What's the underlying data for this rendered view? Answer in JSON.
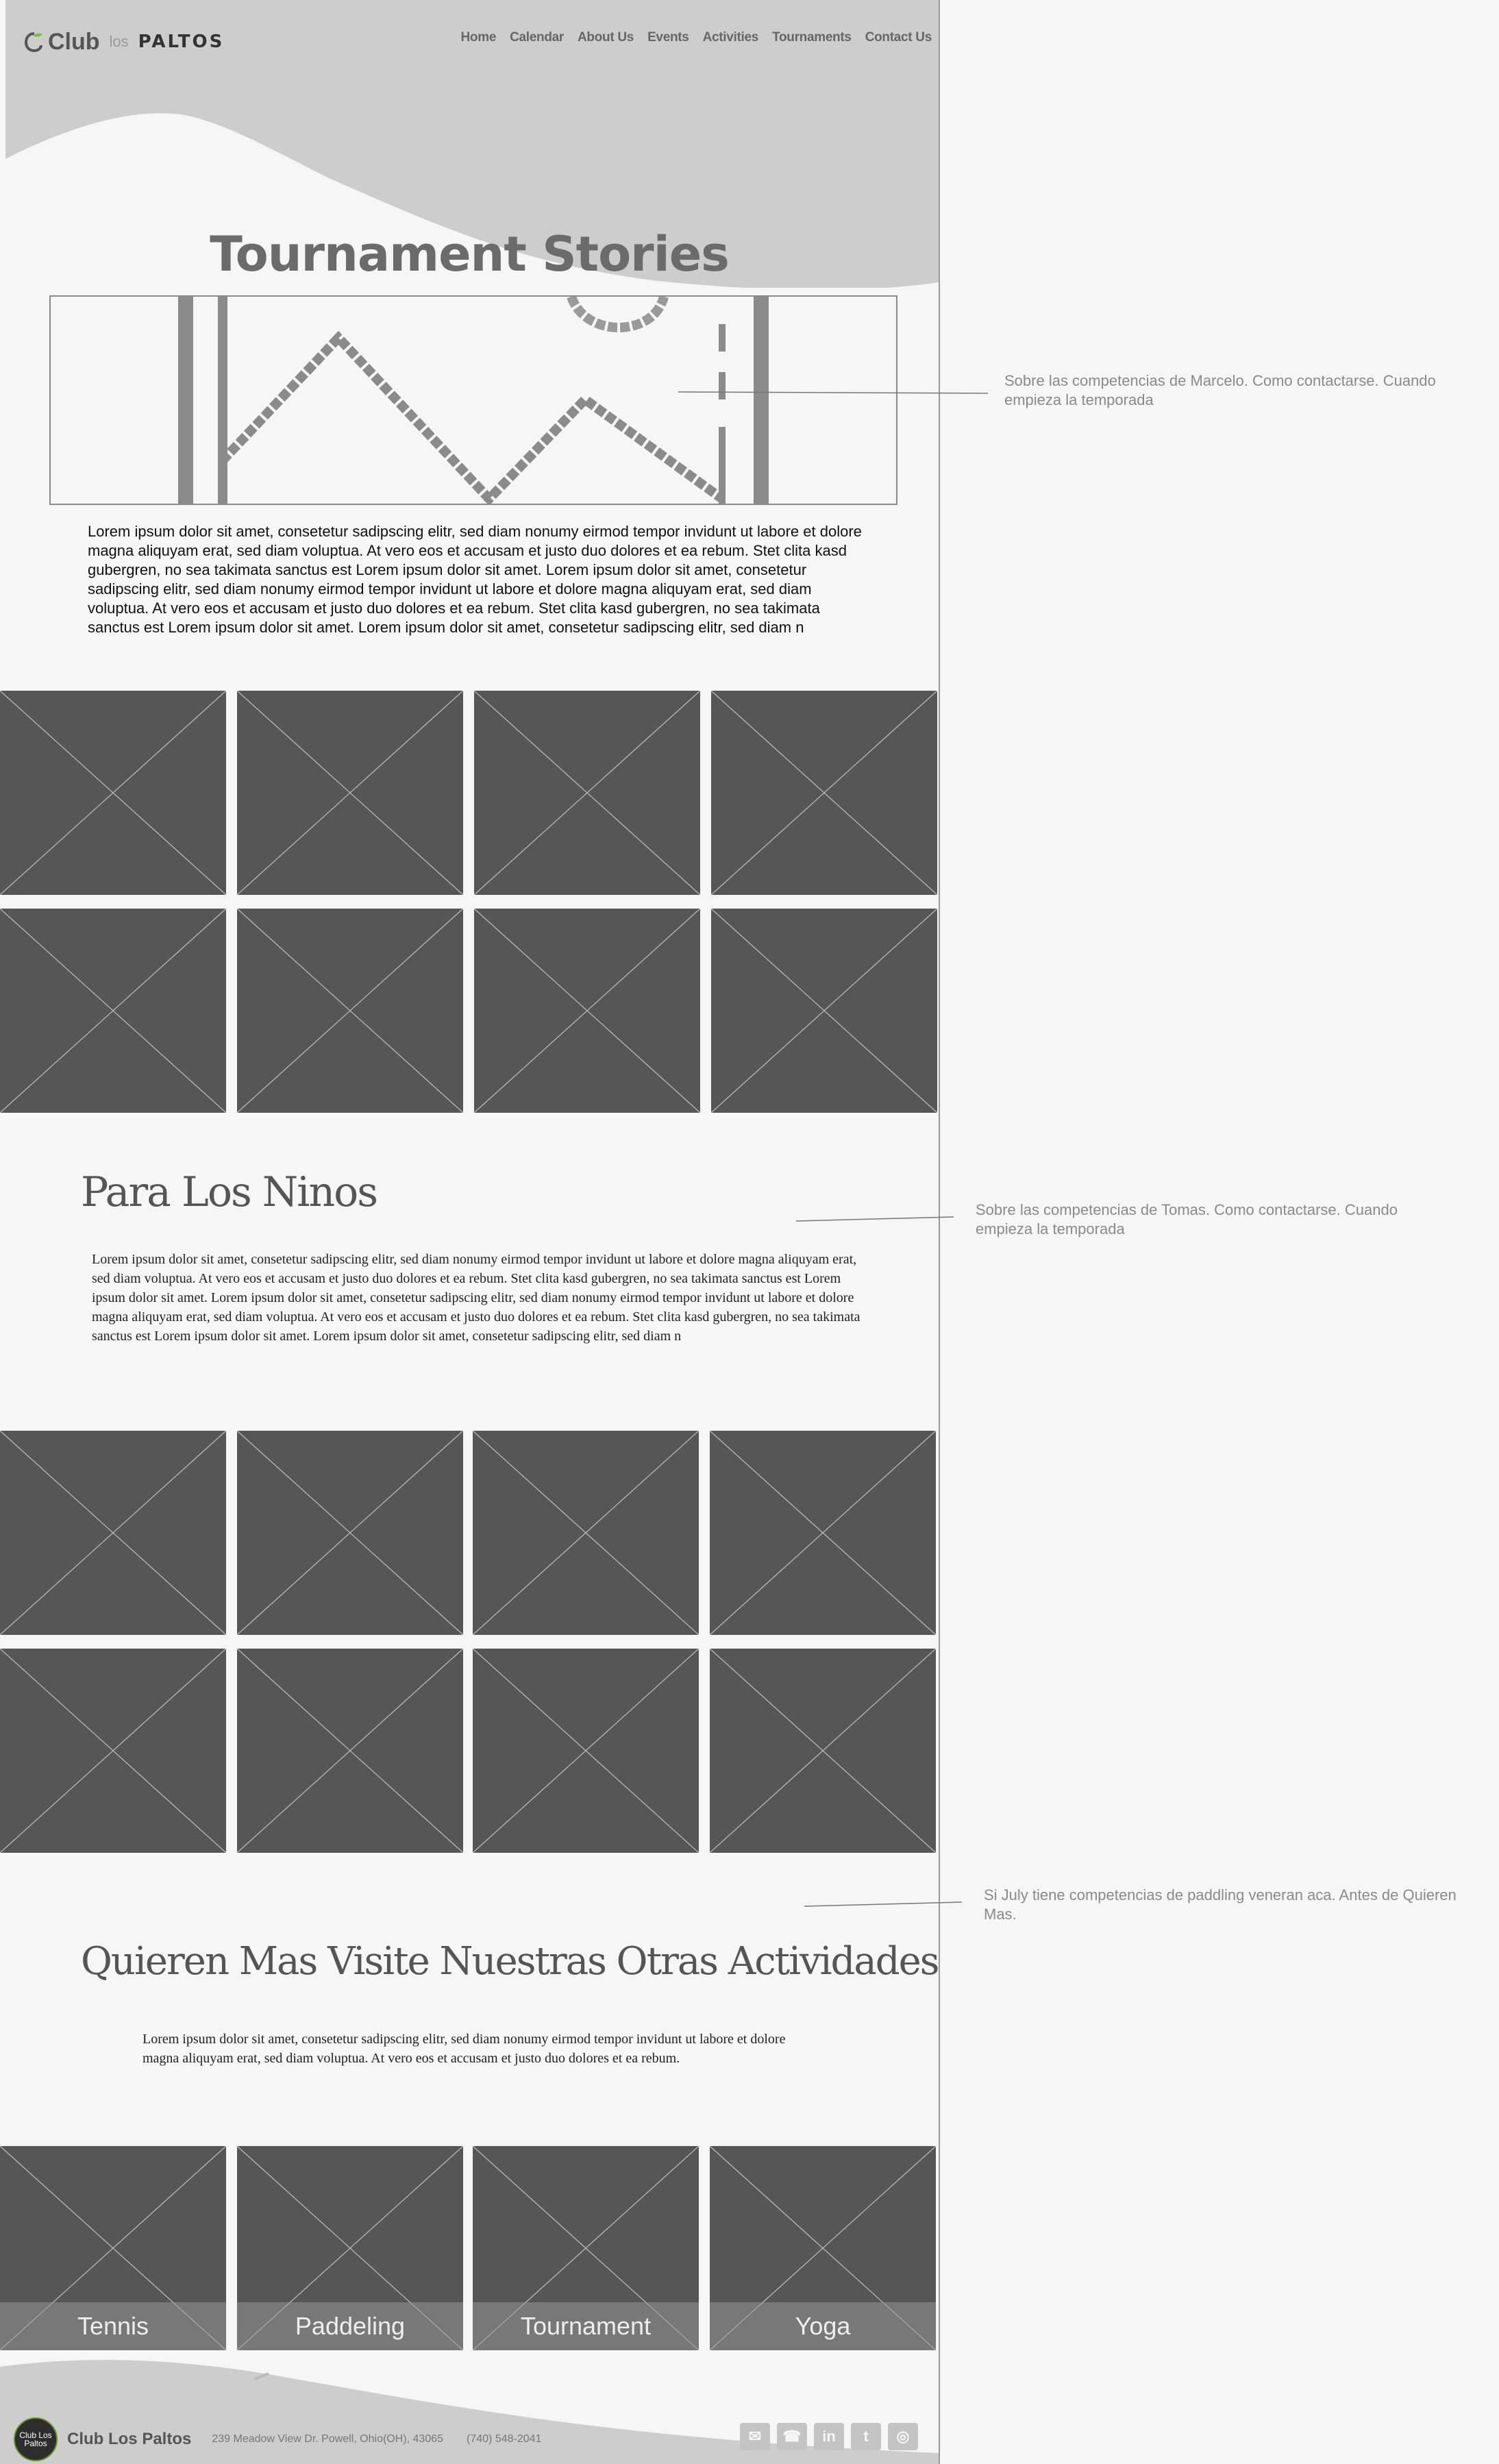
{
  "logo": {
    "c": "Club",
    "los": "los",
    "paltos": "PALTOS"
  },
  "nav": [
    "Home",
    "Calendar",
    "About Us",
    "Events",
    "Activities",
    "Tournaments",
    "Contact Us"
  ],
  "section1": {
    "title": "Tournament Stories",
    "body": "Lorem ipsum dolor sit amet, consetetur sadipscing elitr, sed diam nonumy eirmod tempor invidunt ut labore et dolore magna aliquyam erat, sed diam voluptua. At vero eos et accusam et justo duo dolores et ea rebum. Stet clita kasd gubergren, no sea takimata sanctus est Lorem ipsum dolor sit amet. Lorem ipsum dolor sit amet, consetetur sadipscing elitr, sed diam nonumy eirmod tempor invidunt ut labore et dolore magna aliquyam erat, sed diam voluptua. At vero eos et accusam et justo duo dolores et ea rebum. Stet clita kasd gubergren, no sea takimata sanctus est Lorem ipsum dolor sit amet. Lorem ipsum dolor sit amet, consetetur sadipscing elitr, sed diam n",
    "note": "Sobre las competencias de Marcelo. Como contactarse. Cuando empieza la temporada"
  },
  "section2": {
    "title": "Para Los Ninos",
    "body": "Lorem ipsum dolor sit amet, consetetur sadipscing elitr, sed diam nonumy eirmod tempor invidunt ut labore et dolore magna aliquyam erat, sed diam voluptua. At vero eos et accusam et justo duo dolores et ea rebum. Stet clita kasd gubergren, no sea takimata sanctus est Lorem ipsum dolor sit amet. Lorem ipsum dolor sit amet, consetetur sadipscing elitr, sed diam nonumy eirmod tempor invidunt ut labore et dolore magna aliquyam erat, sed diam voluptua. At vero eos et accusam et justo duo dolores et ea rebum. Stet clita kasd gubergren, no sea takimata sanctus est Lorem ipsum dolor sit amet. Lorem ipsum dolor sit amet, consetetur sadipscing elitr, sed diam n",
    "note": "Sobre las competencias de Tomas. Como contactarse. Cuando empieza la temporada"
  },
  "section3": {
    "title": "Quieren Mas Visite Nuestras Otras Actividades",
    "body": "Lorem ipsum dolor sit amet, consetetur sadipscing elitr, sed diam nonumy eirmod tempor invidunt ut labore et dolore magna aliquyam erat, sed diam voluptua. At vero eos et accusam et justo duo dolores et ea rebum.",
    "note": "Si July tiene competencias de paddling veneran aca. Antes de Quieren Mas.",
    "activities": [
      "Tennis",
      "Paddeling",
      "Tournament",
      "Yoga"
    ]
  },
  "footer": {
    "logo_text": "Club Los Paltos",
    "name": "Club Los Paltos",
    "address": "239 Meadow View Dr. Powell, Ohio(OH), 43065",
    "phone": "(740) 548-2041",
    "social_icons": [
      "mail-icon",
      "phone-icon",
      "linkedin-icon",
      "twitter-icon",
      "instagram-icon"
    ]
  },
  "colors": {
    "placeholder": "#565656",
    "header_gray": "#cdcdcd",
    "text_gray": "#6b6b6b"
  }
}
